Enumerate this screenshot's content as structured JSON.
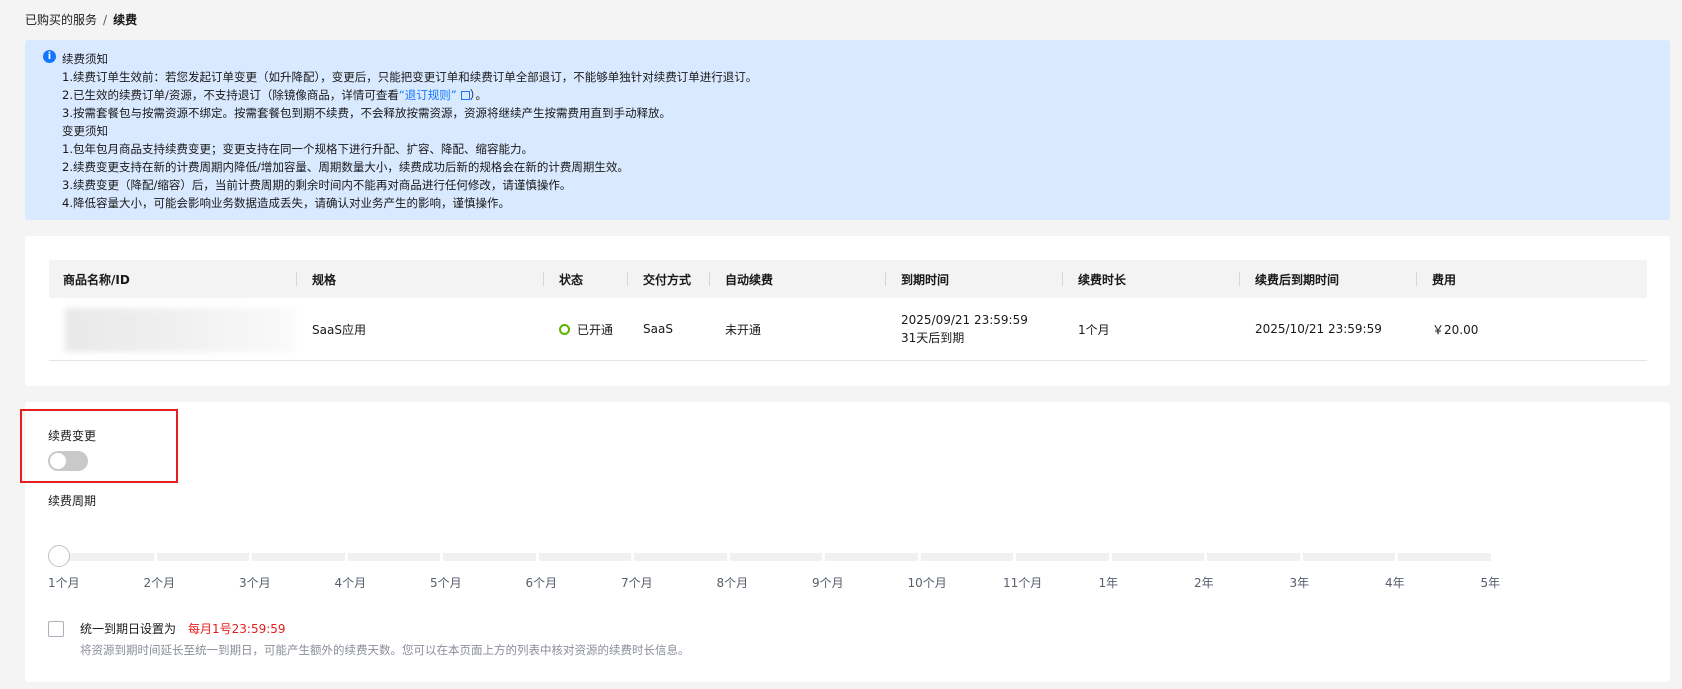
{
  "breadcrumb": {
    "parent": "已购买的服务",
    "separator": "/",
    "current": "续费"
  },
  "notice": {
    "renew_title": "续费须知",
    "renew_items": [
      "1.续费订单生效前：若您发起订单变更（如升降配），变更后，只能把变更订单和续费订单全部退订，不能够单独针对续费订单进行退订。",
      "2.已生效的续费订单/资源，不支持退订（除镜像商品，详情可查看",
      "3.按需套餐包与按需资源不绑定。按需套餐包到期不续费，不会释放按需资源，资源将继续产生按需费用直到手动释放。"
    ],
    "refund_link": "“退订规则”",
    "item2_suffix": "）。",
    "change_title": "变更须知",
    "change_items": [
      "1.包年包月商品支持续费变更；变更支持在同一个规格下进行升配、扩容、降配、缩容能力。",
      "2.续费变更支持在新的计费周期内降低/增加容量、周期数量大小，续费成功后新的规格会在新的计费周期生效。",
      "3.续费变更（降配/缩容）后，当前计费周期的剩余时间内不能再对商品进行任何修改，请谨慎操作。",
      "4.降低容量大小，可能会影响业务数据造成丢失，请确认对业务产生的影响，谨慎操作。"
    ]
  },
  "table": {
    "headers": [
      "商品名称/ID",
      "规格",
      "状态",
      "交付方式",
      "自动续费",
      "到期时间",
      "续费时长",
      "续费后到期时间",
      "费用"
    ],
    "row": {
      "spec": "SaaS应用",
      "status": "已开通",
      "delivery": "SaaS",
      "auto_renew": "未开通",
      "expire_time": "2025/09/21 23:59:59",
      "expire_remaining": "31天后到期",
      "renew_duration": "1个月",
      "new_expire_time": "2025/10/21 23:59:59",
      "fee": "￥20.00"
    }
  },
  "renew": {
    "change_label": "续费变更",
    "change_enabled": false,
    "period_label": "续费周期",
    "period_options": [
      "1个月",
      "2个月",
      "3个月",
      "4个月",
      "5个月",
      "6个月",
      "7个月",
      "8个月",
      "9个月",
      "10个月",
      "11个月",
      "1年",
      "2年",
      "3年",
      "4年",
      "5年"
    ],
    "selected_period": "1个月",
    "unify_label": "统一到期日设置为",
    "unify_time": "每月1号23:59:59",
    "unify_checked": false,
    "unify_desc": "将资源到期时间延长至统一到期日，可能产生额外的续费天数。您可以在本页面上方的列表中核对资源的续费时长信息。"
  },
  "colors": {
    "accent": "#1476ff",
    "notice_bg": "#d9e9ff",
    "status_green": "#5cb300",
    "highlight_red": "#e51e1e"
  }
}
